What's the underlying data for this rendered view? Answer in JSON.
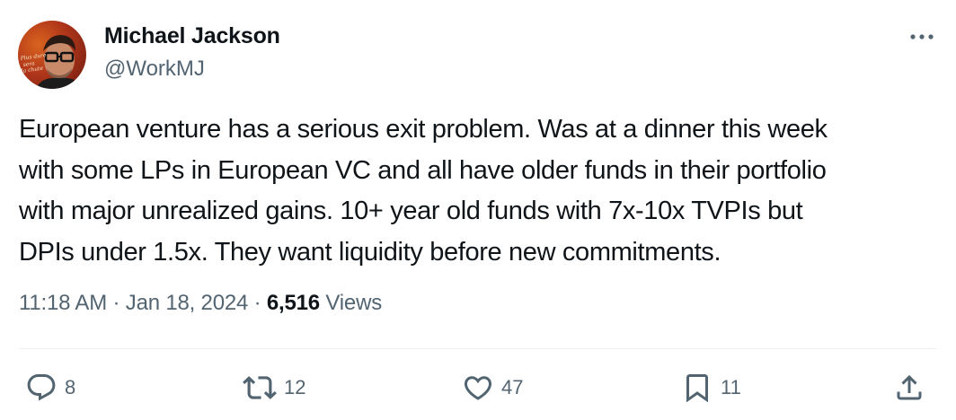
{
  "author": {
    "name": "Michael Jackson",
    "handle": "@WorkMJ",
    "avatar_text": "Plus dure sera la chute"
  },
  "tweet": {
    "lines": [
      "European venture has a serious exit problem. Was at a dinner this week",
      "with some LPs in European VC and all have older funds in their portfolio",
      "with major unrealized gains. 10+ year old funds with 7x-10x TVPIs but",
      "DPIs under 1.5x. They want liquidity before new commitments."
    ]
  },
  "meta": {
    "time": "11:18 AM",
    "separator": "·",
    "date": "Jan 18, 2024",
    "views_count": "6,516",
    "views_label": "Views"
  },
  "actions": {
    "replies": "8",
    "retweets": "12",
    "likes": "47",
    "bookmarks": "11"
  },
  "icons": {
    "more": "more-icon",
    "reply": "reply-icon",
    "retweet": "retweet-icon",
    "like": "heart-icon",
    "bookmark": "bookmark-icon",
    "share": "share-icon"
  },
  "colors": {
    "text": "#0f1419",
    "secondary": "#536471",
    "divider": "#eff3f4"
  }
}
